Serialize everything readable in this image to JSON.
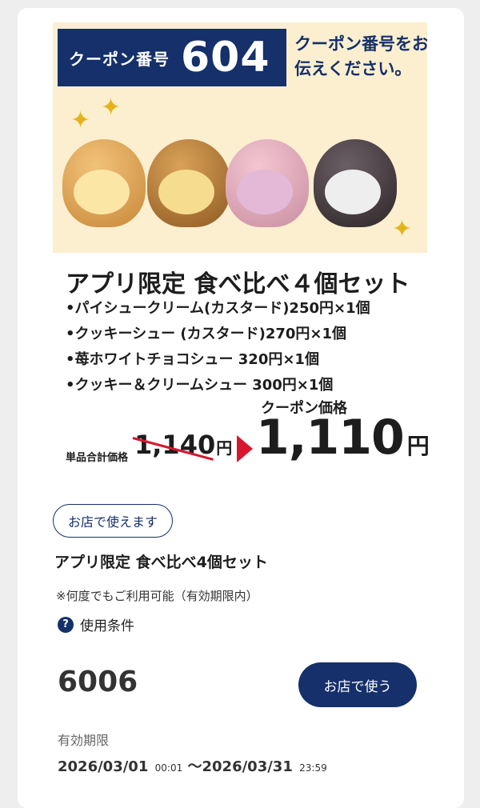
{
  "promo": {
    "coupon_label": "クーポン番号",
    "coupon_number": "604",
    "coupon_note": "クーポン番号をお伝えください。"
  },
  "product": {
    "title": "アプリ限定 食べ比べ４個セット",
    "items": [
      "•パイシュークリーム(カスタード)250円×1個",
      "•クッキーシュー (カスタード)270円×1個",
      "•苺ホワイトチョコシュー 320円×1個",
      "•クッキー＆クリームシュー 300円×1個"
    ]
  },
  "pricing": {
    "regular_label": "単品合計価格",
    "regular_price": "1,140",
    "coupon_price_label": "クーポン価格",
    "coupon_price": "1,110",
    "currency": "円",
    "accent_color": "#d7172f"
  },
  "coupon": {
    "badge": "お店で使えます",
    "name": "アプリ限定 食べ比べ4個セット",
    "note": "※何度でもご利用可能（有効期限内）",
    "terms_label": "使用条件",
    "store_code": "6006",
    "use_button": "お店で使う",
    "validity_label": "有効期限",
    "valid_from_date": "2026/03/01",
    "valid_from_time": "00:01",
    "valid_separator": "～",
    "valid_to_date": "2026/03/31",
    "valid_to_time": "23:59"
  },
  "colors": {
    "brand": "#15306a",
    "promo_background": "#fbefcf"
  }
}
